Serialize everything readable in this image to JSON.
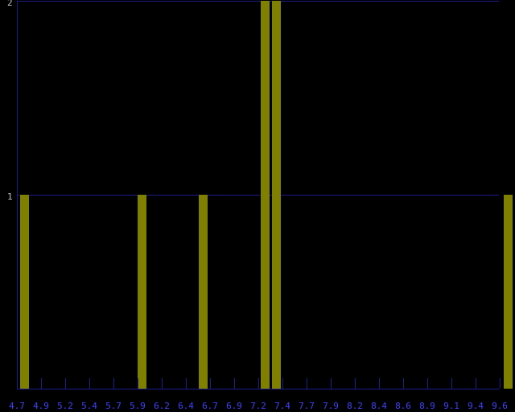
{
  "chart_data": {
    "type": "bar",
    "title": "",
    "xlabel": "",
    "ylabel": "",
    "categories": [
      "4.7",
      "4.9",
      "5.2",
      "5.4",
      "5.7",
      "5.9",
      "6.2",
      "6.4",
      "6.7",
      "6.9",
      "7.2",
      "7.4",
      "7.7",
      "7.9",
      "8.2",
      "8.4",
      "8.6",
      "8.9",
      "9.1",
      "9.4",
      "9.6"
    ],
    "bars": [
      {
        "x": 4.7,
        "value": 1
      },
      {
        "x": 5.95,
        "value": 1
      },
      {
        "x": 6.57,
        "value": 1
      },
      {
        "x": 7.2,
        "value": 2
      },
      {
        "x": 7.32,
        "value": 2
      },
      {
        "x": 9.7,
        "value": 1
      }
    ],
    "xlim": [
      4.67,
      9.72
    ],
    "ylim": [
      0,
      2
    ],
    "yticks": [
      "1",
      "2"
    ],
    "grid": {
      "horizontal": true,
      "vertical": false
    },
    "colors": {
      "background": "#000000",
      "bar": "#808000",
      "axis": "#1c1c8c",
      "gridline": "#1c1c8c",
      "tick_label": "#4040ff",
      "y_tick_label": "#c0c0c0"
    }
  }
}
